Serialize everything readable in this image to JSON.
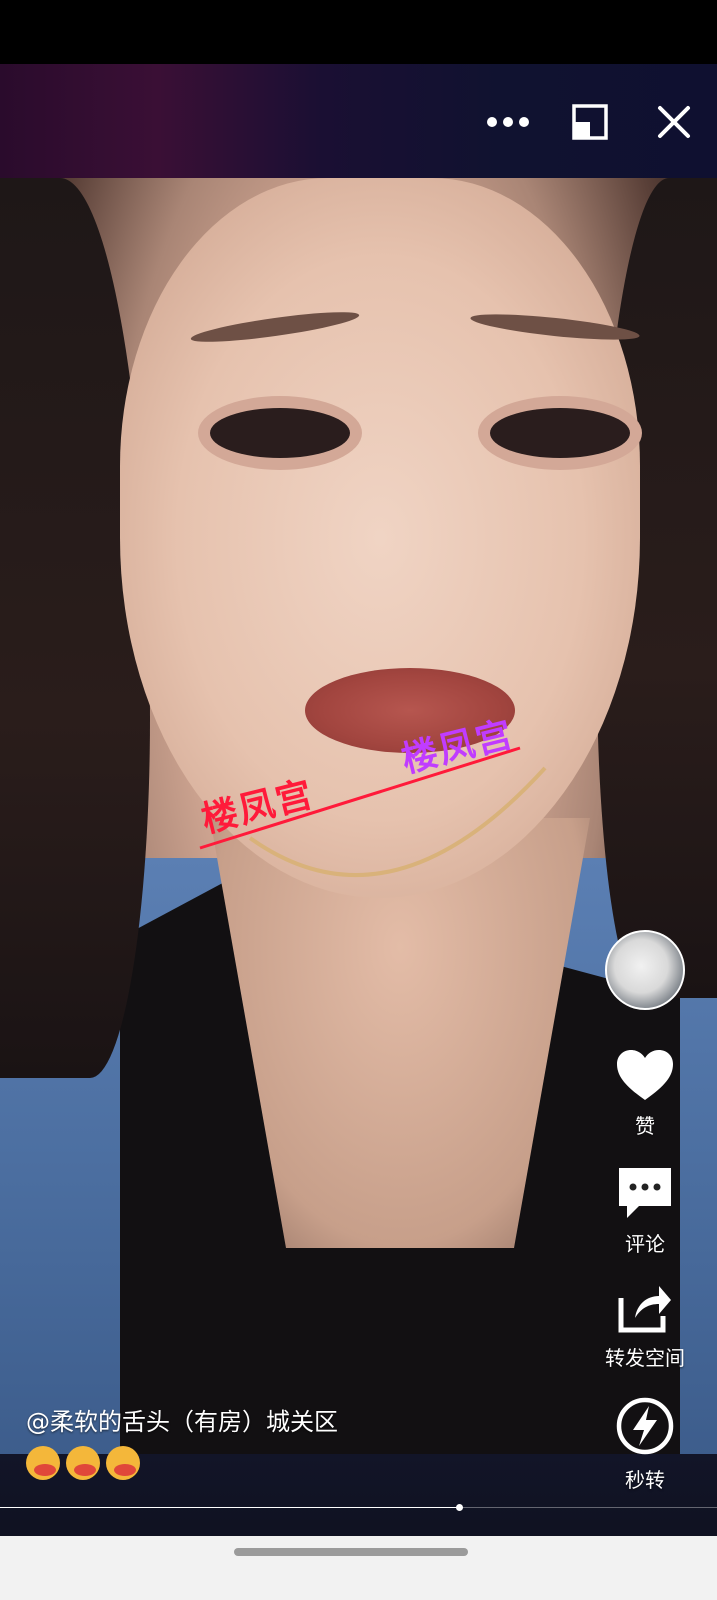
{
  "top_bar": {
    "more_icon": "more-horizontal-icon",
    "minimize_icon": "picture-in-picture-icon",
    "close_icon": "close-icon"
  },
  "video": {
    "watermarks": [
      "楼凤宫",
      "楼凤宫"
    ]
  },
  "actions": {
    "avatar_icon": "cat-avatar",
    "like_label": "赞",
    "comment_label": "评论",
    "share_label": "转发空间",
    "flash_label": "秒转"
  },
  "caption": {
    "text": "@柔软的舌头（有房）城关区",
    "emojis": [
      "drooling-face-emoji",
      "drooling-face-emoji",
      "drooling-face-emoji"
    ]
  },
  "progress": {
    "fraction": 0.64
  },
  "colors": {
    "accent_watermark_red": "#ff1a3a",
    "accent_watermark_purple": "#c03cff"
  }
}
